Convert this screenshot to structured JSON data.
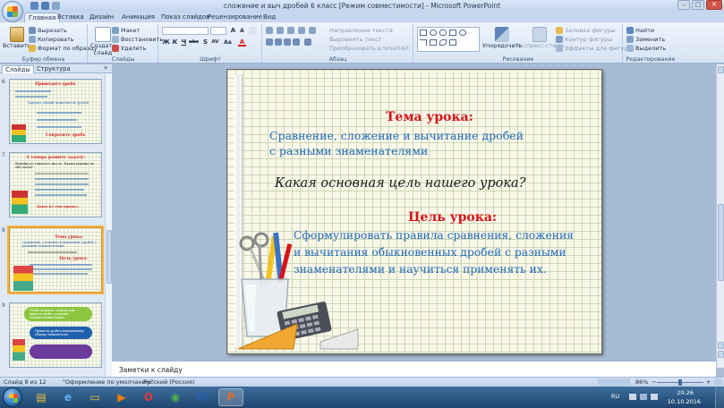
{
  "window": {
    "title": "сложение и выч дробей 6 класс [Режим совместимости] - Microsoft PowerPoint",
    "controls": [
      "–",
      "□",
      "✕"
    ]
  },
  "ribbon_tabs": [
    "Главная",
    "Вставка",
    "Дизайн",
    "Анимация",
    "Показ слайдов",
    "Рецензирование",
    "Вид"
  ],
  "ribbon": {
    "clipboard": {
      "paste": "Вставить",
      "cut": "Вырезать",
      "copy": "Копировать",
      "format_painter": "Формат по образцу",
      "label": "Буфер обмена"
    },
    "slides": {
      "new_slide": "Создать слайд",
      "layout": "Макет",
      "reset": "Восстановить",
      "delete": "Удалить",
      "label": "Слайды"
    },
    "font": {
      "label": "Шрифт",
      "bold": "Ж",
      "italic": "К",
      "underline": "Ч",
      "strike": "abc",
      "shadow": "S",
      "spacing": "AV",
      "case": "Aa",
      "color": "A",
      "grow": "A",
      "shrink": "A"
    },
    "paragraph": {
      "label": "Абзац",
      "text_direction": "Направление текста",
      "align_text": "Выровнять текст",
      "smartart": "Преобразовать в SmartArt"
    },
    "drawing": {
      "label": "Рисование",
      "arrange": "Упорядочить",
      "quick_styles": "Экспресс-стили",
      "fill": "Заливка фигуры",
      "outline": "Контур фигуры",
      "effects": "Эффекты для фигур"
    },
    "editing": {
      "label": "Редактирование",
      "find": "Найти",
      "replace": "Заменить",
      "select": "Выделить"
    }
  },
  "panel": {
    "tabs": [
      "Слайды",
      "Структура"
    ],
    "close": "×"
  },
  "thumbnails": [
    {
      "number": "6",
      "title": "Приведите дробь",
      "text": "Найдите общий знаменатель дробей",
      "footer": "Сократите дробь"
    },
    {
      "number": "7",
      "title": "А теперь решите задачу:",
      "text": "Веревку из тяжелого хвоста. Каким веревка на обе части?",
      "footer": "Какое из этих правил..."
    },
    {
      "number": "8",
      "title": "Тема урока:",
      "text": "Сравнение, сложение и вычитание дробей с разными знаменателями",
      "footer": "Цель урока:"
    },
    {
      "number": "9",
      "title": "",
      "text": "Чтобы сравнить, сложить или вычесть дроби с разными знаменателями нужно:",
      "footer": "Привести дроби к наименьшему общему знаменателю."
    }
  ],
  "slide": {
    "title": "Тема урока:",
    "subtitle_line1": "Сравнение, сложение и вычитание дробей",
    "subtitle_line2": "с разными знаменателями",
    "question": "Какая основная цель нашего урока?",
    "goal_title": "Цель урока:",
    "goal_line1": "Сформулировать правила сравнения, сложения",
    "goal_line2": "и вычитания обыкновенных дробей с разными",
    "goal_line3": "знаменателями и научиться применять их."
  },
  "notes": {
    "placeholder": "Заметки к слайду"
  },
  "statusbar": {
    "slide_info": "Слайд 8 из 12",
    "theme": "\"Оформление по умолчанию\"",
    "language": "Русский (Россия)",
    "zoom": "86%",
    "zoom_level": 0.5
  },
  "taskbar": {
    "apps": [
      "file-explorer",
      "internet-explorer",
      "windows-explorer",
      "media-player",
      "opera",
      "chrome",
      "word",
      "powerpoint"
    ],
    "lang": "RU",
    "time": "20:26",
    "date": "10.10.2016"
  },
  "colors": {
    "accent_title": "#d6141b",
    "accent_text": "#1f69b7",
    "ribbon_bg": "#dde8f7",
    "taskbar": "#2a5a8c"
  }
}
